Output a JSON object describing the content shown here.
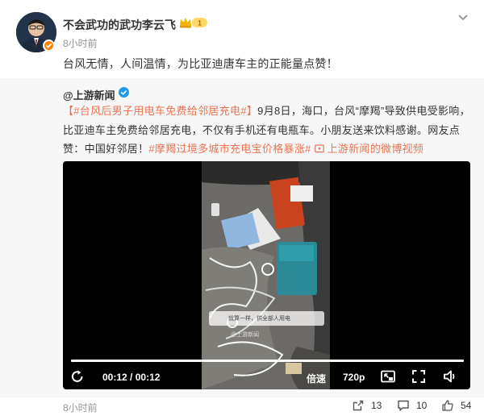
{
  "post": {
    "author": "不会武功的武功李云飞",
    "level_badge": "1",
    "time": "8小时前",
    "text": "台风无情，人间温情，为比亚迪唐车主的正能量点赞！"
  },
  "repost": {
    "source": "@上游新闻",
    "line1": {
      "tag": "【#台风后男子用电车免费给邻居充电#】",
      "text": "9月8日，海口，台风“摩羯”导致供电受影响，"
    },
    "line2": "比亚迪车主免费给邻居充电，不仅有手机还有电瓶车。小朋友送来饮料感谢。网友点",
    "line3": {
      "text": "赞：中国好邻居！",
      "tag": "#摩羯过境多城市充电宝价格暴涨#",
      "link": "上游新闻的微博视频"
    },
    "video": {
      "watermark": "@上游新闻",
      "caption": "就算一样，供全部人用电",
      "current_time": "00:12",
      "separator": "/",
      "duration": "00:12",
      "speed_label": "倍速",
      "quality_label": "720p",
      "progress": 1.0
    }
  },
  "footer": {
    "time": "8小时前",
    "reposts": "13",
    "comments": "10",
    "likes": "54"
  },
  "colors": {
    "link_orange": "#eb7350",
    "verify_orange": "#ff8200",
    "verify_blue": "#1d9bf0",
    "muted_gray": "#939393"
  }
}
